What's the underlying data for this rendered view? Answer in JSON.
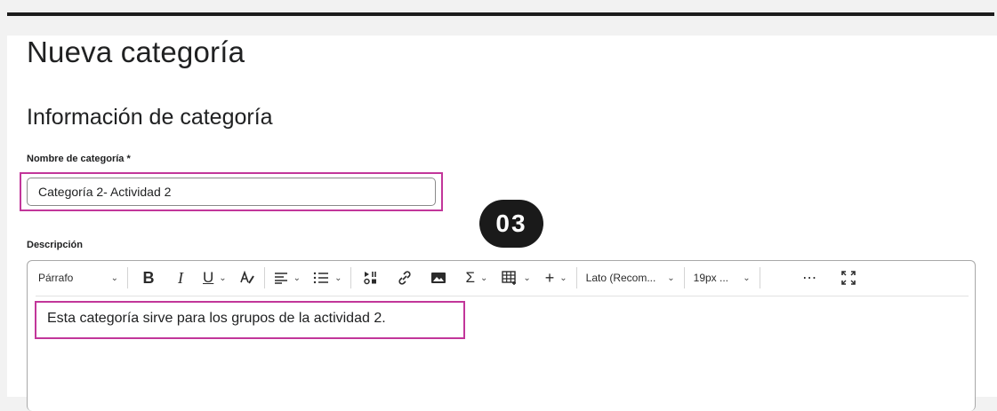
{
  "page": {
    "title": "Nueva categoría",
    "section_title": "Información de categoría"
  },
  "form": {
    "name_label": "Nombre de categoría *",
    "name_value": "Categoría 2- Actividad 2",
    "description_label": "Descripción"
  },
  "badge": {
    "step": "03"
  },
  "editor": {
    "toolbar": {
      "block_format": "Párrafo",
      "font_family": "Lato (Recom...",
      "font_size": "19px ..."
    },
    "content": "Esta categoría sirve para los grupos de la actividad 2."
  },
  "colors": {
    "highlight": "#c2369a",
    "badge_bg": "#1a1a1a"
  },
  "icons": [
    "bold-icon",
    "italic-icon",
    "underline-icon",
    "text-color-icon",
    "align-icon",
    "list-icon",
    "media-icon",
    "link-icon",
    "image-icon",
    "equation-icon",
    "table-icon",
    "insert-icon",
    "more-icon",
    "fullscreen-icon"
  ]
}
